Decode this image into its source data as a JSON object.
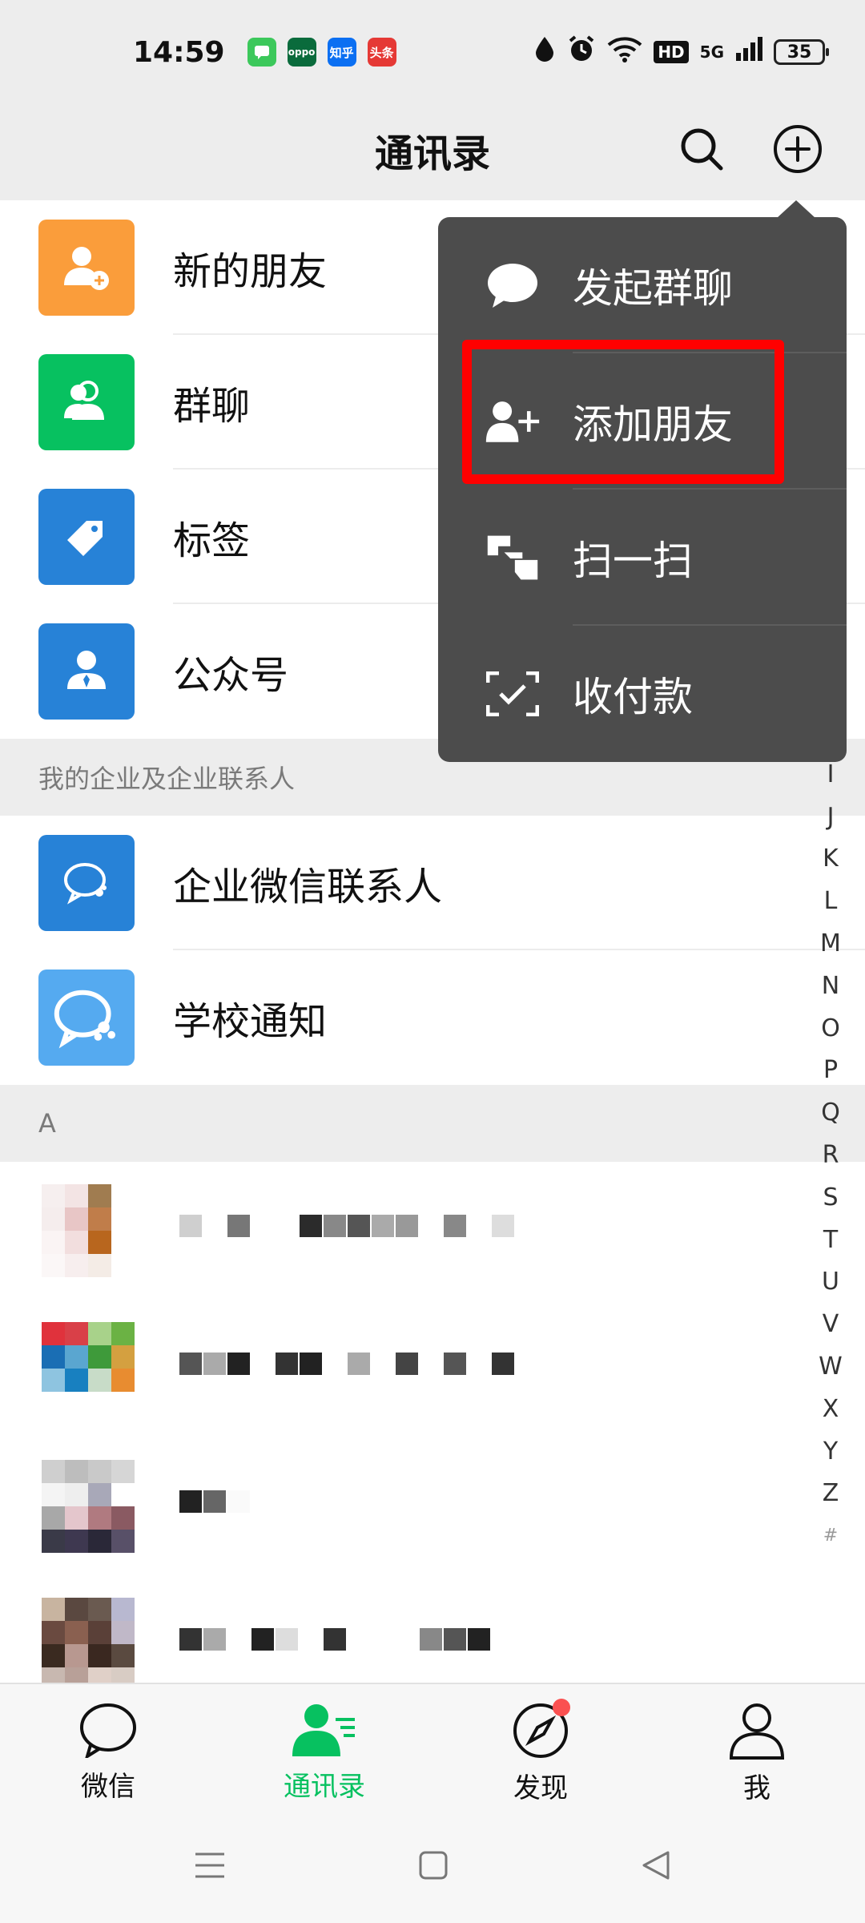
{
  "status_bar": {
    "time": "14:59",
    "apps": [
      {
        "name": "messages-app-icon",
        "text": "",
        "color": "#3cc85b"
      },
      {
        "name": "oppo-app-icon",
        "text": "oppo",
        "color": "#0a6b3c"
      },
      {
        "name": "zhihu-app-icon",
        "text": "知乎",
        "color": "#0b6ff2"
      },
      {
        "name": "toutiao-app-icon",
        "text": "头条",
        "color": "#e53935"
      }
    ],
    "hd": "HD",
    "network": "5G",
    "battery": "35"
  },
  "header": {
    "title": "通讯录"
  },
  "contacts": {
    "fixed_items": [
      {
        "label": "新的朋友",
        "color": "#fa9d3b",
        "icon": "add-friend-icon"
      },
      {
        "label": "群聊",
        "color": "#07c160",
        "icon": "group-icon"
      },
      {
        "label": "标签",
        "color": "#2782d7",
        "icon": "tag-icon"
      },
      {
        "label": "公众号",
        "color": "#2782d7",
        "icon": "official-account-icon"
      }
    ],
    "section_enterprise": "我的企业及企业联系人",
    "enterprise_items": [
      {
        "label": "企业微信联系人",
        "color": "#2782d7",
        "icon": "work-wechat-icon"
      },
      {
        "label": "学校通知",
        "color": "#55aaf0",
        "icon": "school-notice-icon"
      }
    ],
    "section_a": "A"
  },
  "alphabet": [
    "I",
    "J",
    "K",
    "L",
    "M",
    "N",
    "O",
    "P",
    "Q",
    "R",
    "S",
    "T",
    "U",
    "V",
    "W",
    "X",
    "Y",
    "Z",
    "#"
  ],
  "menu": {
    "items": [
      {
        "label": "发起群聊",
        "icon": "chat-bubble-icon"
      },
      {
        "label": "添加朋友",
        "icon": "add-friend-icon"
      },
      {
        "label": "扫一扫",
        "icon": "scan-icon"
      },
      {
        "label": "收付款",
        "icon": "payment-icon"
      }
    ]
  },
  "bottom_nav": {
    "items": [
      {
        "label": "微信",
        "icon": "chats-icon"
      },
      {
        "label": "通讯录",
        "icon": "contacts-icon"
      },
      {
        "label": "发现",
        "icon": "discover-icon"
      },
      {
        "label": "我",
        "icon": "me-icon"
      }
    ],
    "accent": "#07c160"
  }
}
